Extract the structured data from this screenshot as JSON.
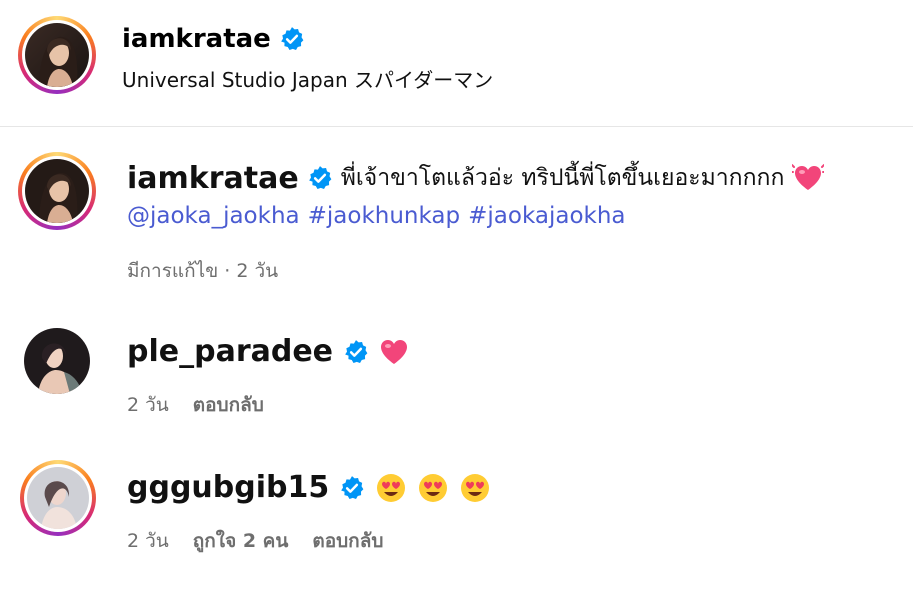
{
  "header": {
    "username": "iamkratae",
    "location": "Universal Studio Japan スパイダーマン"
  },
  "caption": {
    "username": "iamkratae",
    "text": "พี่เจ้าขาโตแล้วอ่ะ ทริปนี้พี่โตขึ้นเยอะมากกกก",
    "emoji": "beating-heart",
    "tags": [
      "@jaoka_jaokha",
      "#jaokhunkap",
      "#jaokajaokha"
    ],
    "meta": "มีการแก้ไข · 2 วัน"
  },
  "comments": [
    {
      "username": "ple_paradee",
      "emoji": "heart",
      "time": "2 วัน",
      "reply": "ตอบกลับ"
    },
    {
      "username": "gggubgib15",
      "emoji": "heart-eyes x3",
      "time": "2 วัน",
      "likes": "ถูกใจ 2 คน",
      "reply": "ตอบกลับ"
    }
  ],
  "colors": {
    "verified": "#0095f6",
    "link": "#4a5bd1",
    "muted": "#6e6e6e",
    "divider": "#e6e6e6"
  }
}
